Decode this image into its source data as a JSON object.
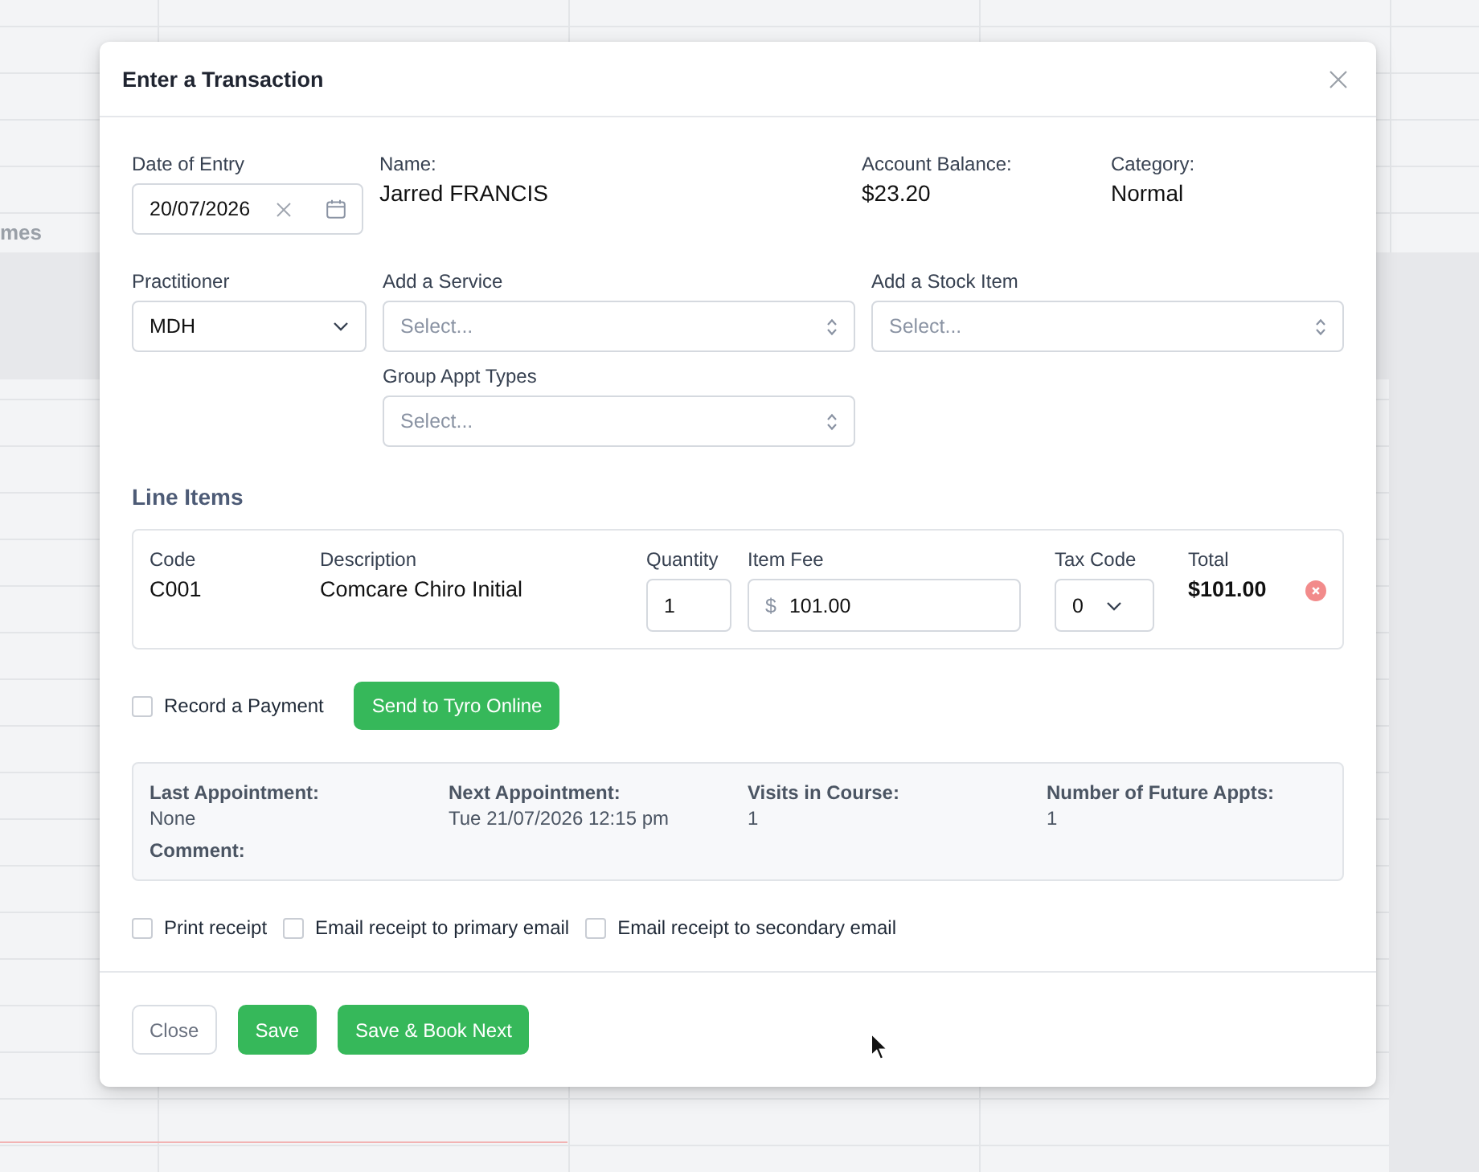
{
  "background": {
    "column_header": "mes"
  },
  "dialog": {
    "title": "Enter a Transaction"
  },
  "date_of_entry": {
    "label": "Date of Entry",
    "value": "20/07/2026"
  },
  "patient_info": [
    {
      "label": "Name:",
      "value": "Jarred FRANCIS"
    },
    {
      "label": "Account Balance:",
      "value": "$23.20"
    },
    {
      "label": "Category:",
      "value": "Normal"
    }
  ],
  "practitioner": {
    "label": "Practitioner",
    "value": "MDH"
  },
  "selects": [
    {
      "label": "Add a Service",
      "placeholder": "Select..."
    },
    {
      "label": "Add a Stock Item",
      "placeholder": "Select..."
    },
    {
      "label": "Group Appt Types",
      "placeholder": "Select..."
    }
  ],
  "line_items": {
    "heading": "Line Items",
    "columns": [
      "Code",
      "Description",
      "Quantity",
      "Item Fee",
      "Tax Code",
      "Total"
    ],
    "rows": [
      {
        "code": "C001",
        "description": "Comcare Chiro Initial",
        "quantity": "1",
        "currency": "$",
        "item_fee": "101.00",
        "tax_code": "0",
        "total": "$101.00"
      }
    ]
  },
  "payment": {
    "record_payment": {
      "label": "Record a Payment",
      "checked": false
    },
    "send_button": "Send to Tyro Online"
  },
  "appointment_info": {
    "items": [
      {
        "label": "Last Appointment:",
        "value": "None"
      },
      {
        "label": "Next Appointment:",
        "value": "Tue 21/07/2026 12:15 pm"
      },
      {
        "label": "Visits in Course:",
        "value": "1"
      },
      {
        "label": "Number of Future Appts:",
        "value": "1"
      }
    ],
    "comment_label": "Comment:"
  },
  "receipt_options": [
    {
      "label": "Print receipt",
      "checked": false
    },
    {
      "label": "Email receipt to primary email",
      "checked": false
    },
    {
      "label": "Email receipt to secondary email",
      "checked": false
    }
  ],
  "footer_buttons": [
    {
      "label": "Close",
      "kind": "secondary"
    },
    {
      "label": "Save",
      "kind": "primary"
    },
    {
      "label": "Save & Book Next",
      "kind": "primary"
    }
  ]
}
